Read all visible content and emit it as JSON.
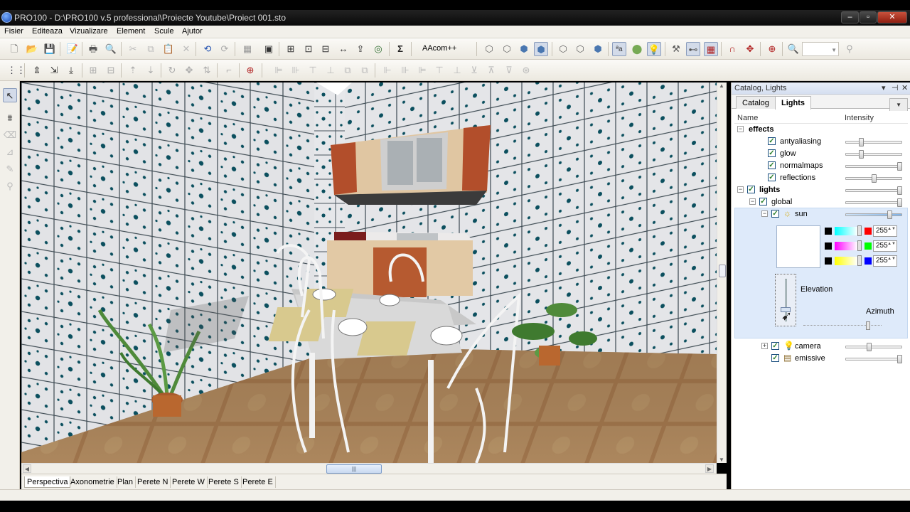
{
  "window": {
    "title": "PRO100 - D:\\PRO100 v.5 professional\\Proiecte Youtube\\Proiect 001.sto",
    "minimize": "‒",
    "maximize": "▫",
    "close": "✕"
  },
  "menu": [
    "Fisier",
    "Editeaza",
    "Vizualizare",
    "Element",
    "Scule",
    "Ajutor"
  ],
  "toolbar": {
    "aacom_label": "AAcom++",
    "zoom_value": ""
  },
  "view_tabs": [
    "Perspectiva",
    "Axonometrie",
    "Plan",
    "Perete N",
    "Perete W",
    "Perete S",
    "Perete E"
  ],
  "active_view_tab": "Perspectiva",
  "panel": {
    "header_title": "Catalog, Lights",
    "tabs": [
      "Catalog",
      "Lights"
    ],
    "active_tab": "Lights",
    "columns": {
      "name": "Name",
      "intensity": "Intensity"
    },
    "rows": [
      {
        "label": "effects",
        "level": 0,
        "group": true,
        "checked": null,
        "intensity": null
      },
      {
        "label": "antyaliasing",
        "level": 1,
        "group": false,
        "checked": true,
        "intensity": 0.25
      },
      {
        "label": "glow",
        "level": 1,
        "group": false,
        "checked": true,
        "intensity": 0.25
      },
      {
        "label": "normalmaps",
        "level": 1,
        "group": false,
        "checked": true,
        "intensity": 1.0
      },
      {
        "label": "reflections",
        "level": 1,
        "group": false,
        "checked": true,
        "intensity": 0.5
      },
      {
        "label": "lights",
        "level": 0,
        "group": true,
        "checked": true,
        "intensity": 1.0
      },
      {
        "label": "global",
        "level": 1,
        "group": true,
        "checked": true,
        "intensity": 1.0
      },
      {
        "label": "sun",
        "level": 2,
        "group": true,
        "checked": true,
        "intensity": 0.8
      },
      {
        "label": "camera",
        "level": 2,
        "group": true,
        "checked": true,
        "intensity": 0.4
      },
      {
        "label": "emissive",
        "level": 2,
        "group": false,
        "checked": true,
        "intensity": 1.0
      }
    ],
    "sun": {
      "rgb": [
        255,
        255,
        255
      ],
      "color_channels": [
        {
          "from": "#000000",
          "mid": "#00ffff",
          "to": "#ff0000",
          "value": "255"
        },
        {
          "from": "#000000",
          "mid": "#ff00ff",
          "to": "#00ff00",
          "value": "255"
        },
        {
          "from": "#000000",
          "mid": "#ffff00",
          "to": "#0000ff",
          "value": "255"
        }
      ],
      "elevation_label": "Elevation",
      "azimuth_label": "Azimuth",
      "elevation": 0.2,
      "azimuth": 0.85
    }
  },
  "colors": {
    "panel_highlight": "#deeafa",
    "check": "#2a7f2a"
  }
}
